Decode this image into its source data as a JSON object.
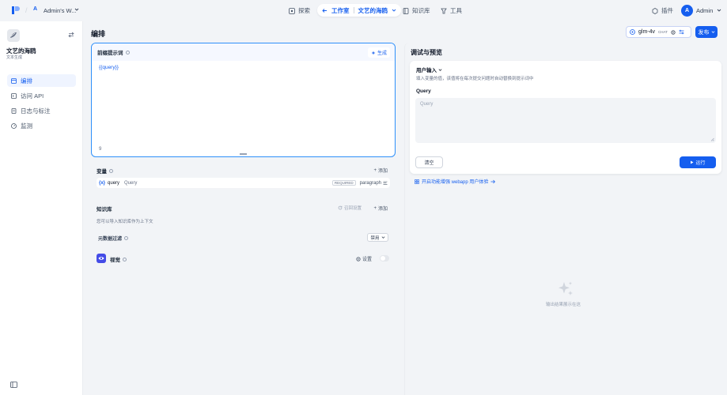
{
  "nav": {
    "workspace_initial": "A",
    "workspace_name": "Admin's W...",
    "explore": "探索",
    "studio": "工作室",
    "current_app": "文艺的海鸥",
    "knowledge": "知识库",
    "tools": "工具",
    "plugins": "插件",
    "user_initial": "A",
    "user_name": "Admin"
  },
  "sidebar": {
    "app_name": "文艺的海鸥",
    "app_type": "文本生成",
    "items": [
      {
        "label": "编排"
      },
      {
        "label": "访问 API"
      },
      {
        "label": "日志与标注"
      },
      {
        "label": "监测"
      }
    ]
  },
  "main": {
    "title": "编排",
    "model_name": "glm-4v",
    "model_tag": "CHAT",
    "publish_label": "发布"
  },
  "prompt": {
    "title": "前缀提示词",
    "generate_label": "生成",
    "content": "{{query}}",
    "char_count": "9"
  },
  "variables": {
    "title": "变量",
    "add_label": "添加",
    "items": [
      {
        "key": "query",
        "label": "Query",
        "required": "REQUIRED",
        "type": "paragraph"
      }
    ]
  },
  "knowledge": {
    "title": "知识库",
    "recall_label": "召回设置",
    "add_label": "添加",
    "empty_text": "您可以导入知识库作为上下文",
    "metadata_title": "元数据过滤",
    "metadata_value": "禁用"
  },
  "vision": {
    "title": "视觉",
    "settings_label": "设置",
    "enabled": false
  },
  "debug": {
    "title": "调试与预览",
    "user_input_label": "用户输入",
    "user_input_desc": "填入变量的值，该值将在每次提交问题时自动替换到提示词中",
    "query_label": "Query",
    "query_placeholder": "Query",
    "clear_label": "清空",
    "run_label": "运行",
    "webapp_link": "开启功能增强 webapp 用户体验",
    "empty_output": "输出结果展示在这"
  },
  "colors": {
    "accent": "#155eef",
    "vision_icon": "#444ce7",
    "prompt_border": "#2e90fa"
  }
}
